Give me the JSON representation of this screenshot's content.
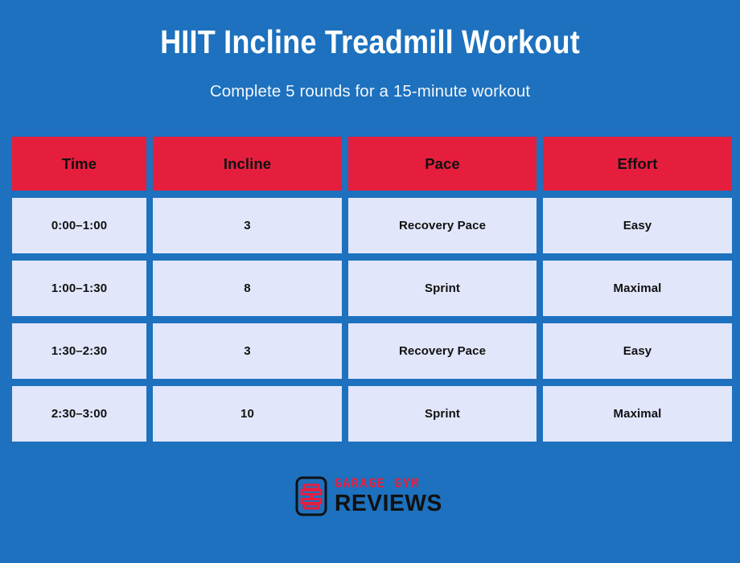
{
  "theme": {
    "background_color": "#1d71be",
    "header_cell_color": "#e51e3e",
    "data_cell_color": "#e1e6fa",
    "title_color": "#ffffff",
    "text_color": "#111111"
  },
  "header": {
    "title": "HIIT Incline Treadmill Workout",
    "subtitle": "Complete 5 rounds for a 15-minute workout"
  },
  "table": {
    "columns": [
      "Time",
      "Incline",
      "Pace",
      "Effort"
    ],
    "rows": [
      {
        "time": "0:00–1:00",
        "incline": "3",
        "pace": "Recovery Pace",
        "effort": "Easy"
      },
      {
        "time": "1:00–1:30",
        "incline": "8",
        "pace": "Sprint",
        "effort": "Maximal"
      },
      {
        "time": "1:30–2:30",
        "incline": "3",
        "pace": "Recovery Pace",
        "effort": "Easy"
      },
      {
        "time": "2:30–3:00",
        "incline": "10",
        "pace": "Sprint",
        "effort": "Maximal"
      }
    ]
  },
  "logo": {
    "mark_icon": "barbell-icon",
    "line1": "GARAGE GYM",
    "line2": "REVIEWS",
    "line1_color": "#e51e3e",
    "line2_color": "#111111"
  }
}
